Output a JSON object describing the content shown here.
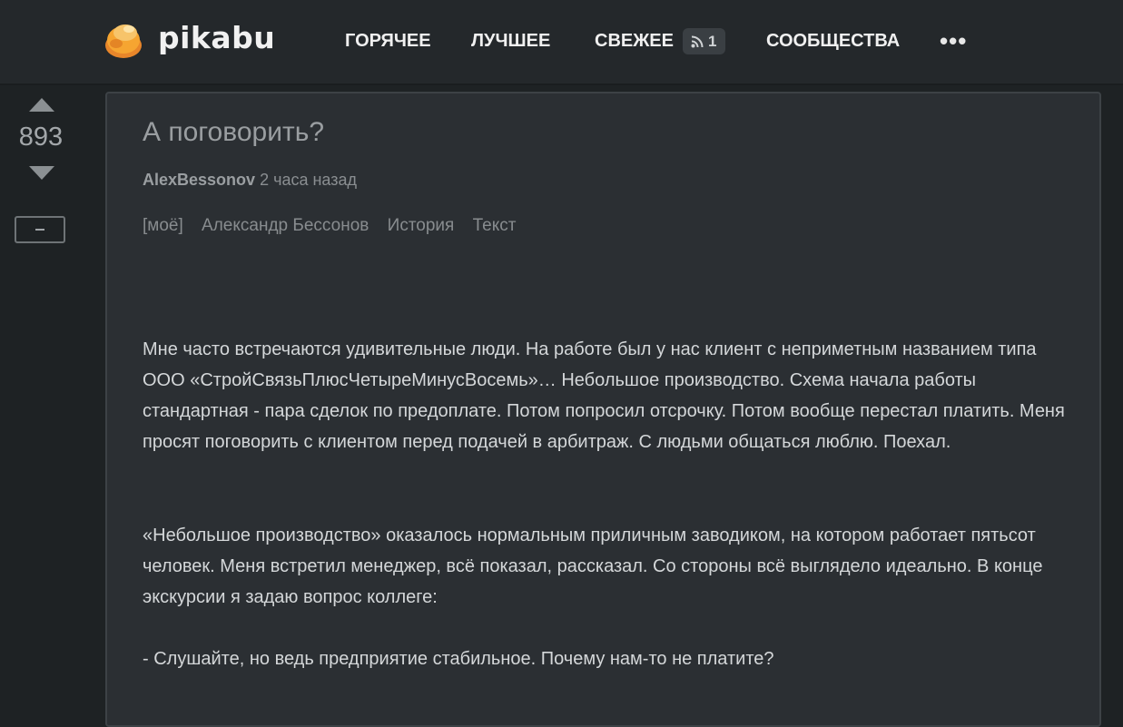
{
  "header": {
    "logo_text": "pikabu",
    "nav": {
      "hot": "ГОРЯЧЕЕ",
      "best": "ЛУЧШЕЕ",
      "fresh": "СВЕЖЕЕ",
      "fresh_badge": "1",
      "communities": "СООБЩЕСТВА",
      "more": "•••"
    }
  },
  "post": {
    "rating": "893",
    "title": "А поговорить?",
    "author": "AlexBessonov",
    "time": "2 часа назад",
    "tags": [
      "[моё]",
      "Александр Бессонов",
      "История",
      "Текст"
    ],
    "paragraphs": [
      "Мне часто встречаются удивительные люди. На работе был у нас клиент с неприметным названием типа ООО «СтройСвязьПлюсЧетыреМинусВосемь»… Небольшое производство. Схема начала работы стандартная - пара сделок по предоплате. Потом попросил отсрочку. Потом вообще перестал платить. Меня просят поговорить с клиентом перед подачей в арбитраж. С людьми общаться люблю. Поехал.",
      "«Небольшое производство» оказалось нормальным приличным заводиком, на котором работает пятьсот человек. Меня встретил менеджер, всё показал, рассказал. Со стороны всё выглядело идеально. В конце экскурсии я задаю вопрос коллеге:",
      "- Слушайте, но ведь предприятие стабильное. Почему нам-то не платите?"
    ]
  },
  "colors": {
    "background": "#1e2224",
    "header": "#24282b",
    "card": "#2b2f33",
    "logo_orange": "#f5a623"
  }
}
